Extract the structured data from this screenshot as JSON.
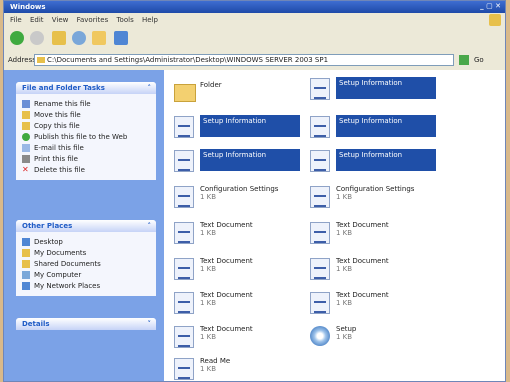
{
  "window": {
    "title": "Windows",
    "controls": "_ ▢ ✕"
  },
  "menu": [
    "File",
    "Edit",
    "View",
    "Favorites",
    "Tools",
    "Help"
  ],
  "address": {
    "label": "Address",
    "path": "C:\\Documents and Settings\\Administrator\\Desktop\\WINDOWS SERVER 2003 SP1",
    "links": "Go"
  },
  "tasks": {
    "file_tasks": {
      "title": "File and Folder Tasks",
      "items": [
        "Rename this file",
        "Move this file",
        "Copy this file",
        "Publish this file to the Web",
        "E-mail this file",
        "Print this file",
        "Delete this file"
      ]
    },
    "other_places": {
      "title": "Other Places",
      "items": [
        "Desktop",
        "My Documents",
        "Shared Documents",
        "My Computer",
        "My Network Places"
      ]
    },
    "details": {
      "title": "Details"
    }
  },
  "files": [
    {
      "name": "Folder",
      "sub": "",
      "type": "folder",
      "selected": false
    },
    {
      "name": "Setup Information",
      "sub": "",
      "type": "doc",
      "selected": true
    },
    {
      "name": "Setup Information",
      "sub": "",
      "type": "doc",
      "selected": true
    },
    {
      "name": "Setup Information",
      "sub": "",
      "type": "doc",
      "selected": true
    },
    {
      "name": "Setup Information",
      "sub": "",
      "type": "doc",
      "selected": true
    },
    {
      "name": "Setup Information",
      "sub": "",
      "type": "doc",
      "selected": true
    },
    {
      "name": "Configuration Settings",
      "sub": "1 KB",
      "type": "doc",
      "selected": false
    },
    {
      "name": "Configuration Settings",
      "sub": "1 KB",
      "type": "doc",
      "selected": false
    },
    {
      "name": "Text Document",
      "sub": "1 KB",
      "type": "doc",
      "selected": false
    },
    {
      "name": "Text Document",
      "sub": "1 KB",
      "type": "doc",
      "selected": false
    },
    {
      "name": "Text Document",
      "sub": "1 KB",
      "type": "doc",
      "selected": false
    },
    {
      "name": "Text Document",
      "sub": "1 KB",
      "type": "doc",
      "selected": false
    },
    {
      "name": "Text Document",
      "sub": "1 KB",
      "type": "doc",
      "selected": false
    },
    {
      "name": "Text Document",
      "sub": "1 KB",
      "type": "doc",
      "selected": false
    },
    {
      "name": "Text Document",
      "sub": "1 KB",
      "type": "doc",
      "selected": false
    },
    {
      "name": "Setup",
      "sub": "1 KB",
      "type": "cd",
      "selected": false
    },
    {
      "name": "Read Me",
      "sub": "1 KB",
      "type": "doc",
      "selected": false
    }
  ]
}
